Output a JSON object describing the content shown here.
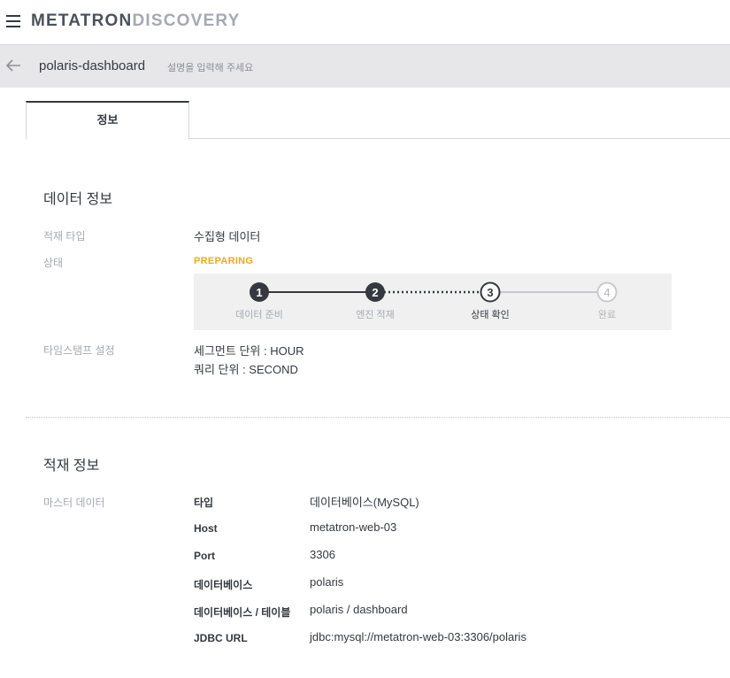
{
  "header": {
    "brand_part1": "METATRON",
    "brand_part2": "DISCOVERY"
  },
  "subheader": {
    "datasource_name": "polaris-dashboard",
    "description_placeholder": "설명을 입력해 주세요"
  },
  "tabs": [
    {
      "label": "정보",
      "active": true
    }
  ],
  "data_info": {
    "title": "데이터 정보",
    "ingest_type_label": "적재 타입",
    "ingest_type_value": "수집형 데이터",
    "status_label": "상태",
    "status_value": "PREPARING",
    "status_color": "#f2a81d",
    "steps": [
      {
        "number": "1",
        "label": "데이터 준비",
        "state": "done"
      },
      {
        "number": "2",
        "label": "엔진 적재",
        "state": "done"
      },
      {
        "number": "3",
        "label": "상태 확인",
        "state": "current"
      },
      {
        "number": "4",
        "label": "완료",
        "state": "pending"
      }
    ],
    "timestamp_label": "타임스탬프 설정",
    "segment_unit": "세그먼트 단위 : HOUR",
    "query_unit": "쿼리 단위 : SECOND"
  },
  "ingest_info": {
    "title": "적재 정보",
    "master_label": "마스터 데이터",
    "rows": [
      {
        "key": "타입",
        "value": "데이터베이스(MySQL)"
      },
      {
        "key": "Host",
        "value": "metatron-web-03"
      },
      {
        "key": "Port",
        "value": "3306"
      },
      {
        "key": "데이터베이스",
        "value": "polaris"
      },
      {
        "key": "데이터베이스 / 테이블",
        "value": "polaris / dashboard"
      },
      {
        "key": "JDBC URL",
        "value": "jdbc:mysql://metatron-web-03:3306/polaris"
      }
    ]
  },
  "icons": {
    "menu": "hamburger-menu-icon",
    "back": "arrow-left-icon"
  },
  "colors": {
    "dark": "#35393f",
    "muted": "#a6a9b0",
    "accent": "#f2a81d",
    "subheader_bg": "#e7e7ea"
  }
}
